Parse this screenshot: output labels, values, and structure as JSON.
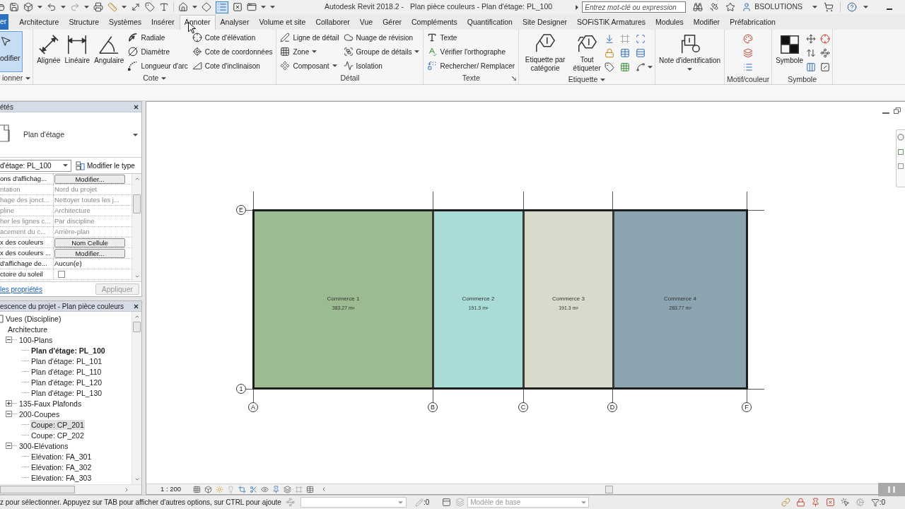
{
  "window": {
    "app_title": "Autodesk Revit 2018.2 -",
    "document_title": "Plan pièce couleurs - Plan d'étage: PL_100"
  },
  "quick_access": {
    "thin_lines": {
      "on": true
    }
  },
  "search": {
    "placeholder": "Entrez mot-clé ou expression"
  },
  "user": {
    "name": "BSOLUTIONS"
  },
  "tabs": [
    {
      "label": "er",
      "kind": "file",
      "selected": false
    },
    {
      "label": "Architecture",
      "kind": "tab",
      "selected": false
    },
    {
      "label": "Structure",
      "kind": "tab",
      "selected": false
    },
    {
      "label": "Systèmes",
      "kind": "tab",
      "selected": false
    },
    {
      "label": "Insérer",
      "kind": "tab",
      "selected": false
    },
    {
      "label": "Annoter",
      "kind": "tab",
      "selected": true
    },
    {
      "label": "Analyser",
      "kind": "tab",
      "selected": false
    },
    {
      "label": "Volume et site",
      "kind": "tab",
      "selected": false
    },
    {
      "label": "Collaborer",
      "kind": "tab",
      "selected": false
    },
    {
      "label": "Vue",
      "kind": "tab",
      "selected": false
    },
    {
      "label": "Gérer",
      "kind": "tab",
      "selected": false
    },
    {
      "label": "Compléments",
      "kind": "tab",
      "selected": false
    },
    {
      "label": "Quantification",
      "kind": "tab",
      "selected": false
    },
    {
      "label": "Site Designer",
      "kind": "tab",
      "selected": false
    },
    {
      "label": "SOFiSTiK Armatures",
      "kind": "tab",
      "selected": false
    },
    {
      "label": "Modules",
      "kind": "tab",
      "selected": false
    },
    {
      "label": "Modifier",
      "kind": "tab",
      "selected": false
    },
    {
      "label": "Préfabrication",
      "kind": "tab",
      "selected": false
    }
  ],
  "select_panel": {
    "button": "odifier",
    "active": true,
    "label": "ionner",
    "dropdown": true
  },
  "ribbon_panels": [
    {
      "label": "Cote",
      "dropdown": true,
      "buttons": [
        {
          "kind": "large",
          "label": "Alignée"
        },
        {
          "kind": "large",
          "label": "Linéaire"
        },
        {
          "kind": "large",
          "label": "Angulaire"
        },
        {
          "kind": "small",
          "label": "Radiale"
        },
        {
          "kind": "small",
          "label": "Diamètre"
        },
        {
          "kind": "small",
          "label": "Longueur d'arc"
        },
        {
          "kind": "small",
          "label": "Cote d'élévation"
        },
        {
          "kind": "small",
          "label": "Cote de coordonnées"
        },
        {
          "kind": "small",
          "label": "Cote d'inclinaison"
        }
      ]
    },
    {
      "label": "Détail",
      "buttons": [
        {
          "kind": "small",
          "label": "Ligne de détail"
        },
        {
          "kind": "small",
          "label": "Zone",
          "dropdown": true
        },
        {
          "kind": "small",
          "label": "Composant",
          "dropdown": true
        },
        {
          "kind": "small",
          "label": "Nuage de révision"
        },
        {
          "kind": "small",
          "label": "Groupe de détails",
          "dropdown": true
        },
        {
          "kind": "small",
          "label": "Isolation"
        }
      ]
    },
    {
      "label": "Texte",
      "launcher": true,
      "buttons": [
        {
          "kind": "small",
          "label": "Texte"
        },
        {
          "kind": "small",
          "label": "Vérifier l'orthographe"
        },
        {
          "kind": "small",
          "label": "Rechercher/ Remplacer"
        }
      ]
    },
    {
      "label": "Etiquette",
      "dropdown": true,
      "buttons": [
        {
          "kind": "large",
          "label": "Etiquette par catégorie"
        },
        {
          "kind": "large",
          "label": "Tout étiqueter"
        }
      ]
    },
    {
      "buttons": [
        {
          "kind": "large",
          "label": "Note d'identification",
          "dropdown": true
        }
      ]
    },
    {
      "label": "Motif/couleur"
    },
    {
      "label": "Symbole",
      "buttons": [
        {
          "kind": "large",
          "label": "Symbole"
        }
      ]
    }
  ],
  "properties": {
    "title": "étés",
    "type_name": "Plan d'étage",
    "instance_filter": "d'étage: PL_100",
    "edit_type": "Modifier le type",
    "rows": [
      {
        "label": "ons d'affichag...",
        "kind": "button",
        "value": "Modifier...",
        "disabled": false
      },
      {
        "label": "ntation",
        "kind": "text",
        "value": "Nord du projet",
        "disabled": true
      },
      {
        "label": "hage des jonct...",
        "kind": "text",
        "value": "Nettoyer toutes les j...",
        "disabled": true
      },
      {
        "label": "pline",
        "kind": "text",
        "value": "Architecture",
        "disabled": true
      },
      {
        "label": "her les lignes c...",
        "kind": "text",
        "value": "Par discipline",
        "disabled": true
      },
      {
        "label": "acement du c...",
        "kind": "text",
        "value": "Arrière-plan",
        "disabled": true
      },
      {
        "label": "x des couleurs",
        "kind": "button",
        "value": "Nom Cellule",
        "disabled": false
      },
      {
        "label": "x des couleurs ...",
        "kind": "button",
        "value": "Modifier...",
        "disabled": false
      },
      {
        "label": "d'affichage de...",
        "kind": "text",
        "value": "Aucun(e)",
        "disabled": false
      },
      {
        "label": "ctoire du soleil",
        "kind": "checkbox",
        "checked": false,
        "disabled": false
      }
    ],
    "help_link": "les propriétés",
    "apply": {
      "label": "Appliquer",
      "disabled": true
    }
  },
  "project_browser": {
    "title": "escence du projet - Plan pièce couleurs",
    "tree": [
      {
        "label": "Vues (Discipline)",
        "selected": false,
        "children": [
          {
            "label": "Architecture",
            "selected": false,
            "children": [
              {
                "label": "100-Plans",
                "expanded": true,
                "selected": false,
                "children": [
                  {
                    "label": "Plan d'étage: PL_100",
                    "current": true,
                    "selected": false
                  },
                  {
                    "label": "Plan d'étage: PL_101",
                    "current": false,
                    "selected": false
                  },
                  {
                    "label": "Plan d'étage: PL_110",
                    "current": false,
                    "selected": false
                  },
                  {
                    "label": "Plan d'étage: PL_120",
                    "current": false,
                    "selected": false
                  },
                  {
                    "label": "Plan d'étage: PL_130",
                    "current": false,
                    "selected": false
                  }
                ]
              },
              {
                "label": "135-Faux Plafonds",
                "expanded": false,
                "selected": false
              },
              {
                "label": "200-Coupes",
                "expanded": true,
                "selected": false,
                "children": [
                  {
                    "label": "Coupe: CP_201",
                    "current": false,
                    "selected": true
                  },
                  {
                    "label": "Coupe: CP_202",
                    "current": false,
                    "selected": false
                  }
                ]
              },
              {
                "label": "300-Elévations",
                "expanded": true,
                "selected": false,
                "children": [
                  {
                    "label": "Elévation: FA_301",
                    "current": false,
                    "selected": false
                  },
                  {
                    "label": "Elévation: FA_302",
                    "current": false,
                    "selected": false
                  },
                  {
                    "label": "Elévation: FA_303",
                    "current": false,
                    "selected": false
                  }
                ]
              }
            ]
          }
        ]
      }
    ]
  },
  "view": {
    "grid_rows": [
      {
        "label": "E"
      },
      {
        "label": "1"
      }
    ],
    "grid_columns": [
      {
        "label": "A"
      },
      {
        "label": "B"
      },
      {
        "label": "C"
      },
      {
        "label": "D"
      },
      {
        "label": "F"
      }
    ],
    "rooms": [
      {
        "name": "Commerce 1",
        "area": "383.27 m²",
        "color": "#9dbb93"
      },
      {
        "name": "Commerce 2",
        "area": "191.3 m²",
        "color": "#a9dcd6"
      },
      {
        "name": "Commerce 3",
        "area": "191.3 m²",
        "color": "#d7dbcc"
      },
      {
        "name": "Commerce 4",
        "area": "283.77 m²",
        "color": "#8ba4b0"
      }
    ],
    "scale": "1 : 200"
  },
  "status_bar": {
    "message": "z pour sélectionner. Appuyez sur TAB pour afficher d'autres options, sur CTRL pour ajoute",
    "selection_count": ":0",
    "workset": {
      "label": "Modèle de base",
      "disabled": true
    },
    "filter_count": ":0"
  }
}
